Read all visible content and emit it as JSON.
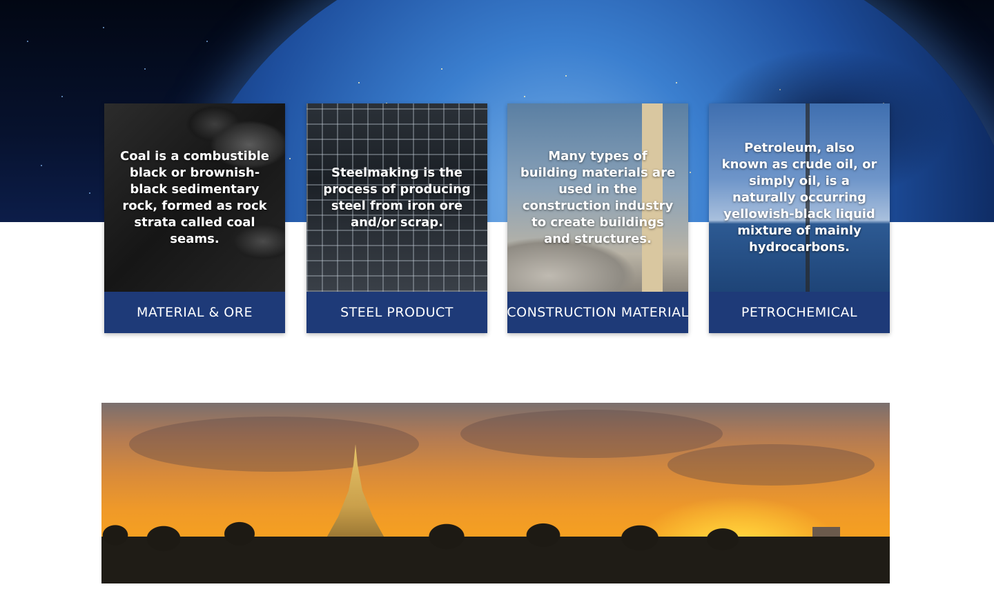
{
  "cards": [
    {
      "description": "Coal is a combustible black or brownish-black sedimentary rock, formed as rock strata called coal seams.",
      "label": "MATERIAL & ORE"
    },
    {
      "description": "Steelmaking is the process of producing steel from iron ore and/or scrap.",
      "label": "STEEL PRODUCT"
    },
    {
      "description": "Many types of building materials are used in the construction industry to create buildings and structures.",
      "label": "CONSTRUCTION MATERIAL"
    },
    {
      "description": "Petroleum, also known as crude oil, or simply oil, is a naturally occurring yellowish-black liquid mixture of mainly hydrocarbons.",
      "label": "PETROCHEMICAL"
    }
  ],
  "colors": {
    "card_label_bg": "#1e3a78",
    "text_white": "#ffffff"
  }
}
